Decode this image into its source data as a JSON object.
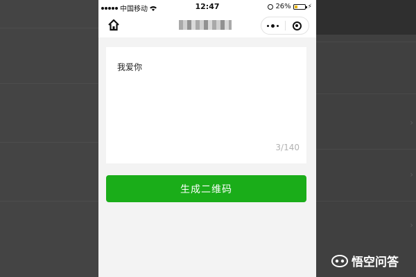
{
  "status_bar": {
    "carrier": "中国移动",
    "time": "12:47",
    "battery": "26%",
    "battery_level": 0.26,
    "battery_color": "#e8b400"
  },
  "nav": {
    "home_icon": "home-icon",
    "more_icon": "more-dots-icon",
    "close_icon": "target-close-icon"
  },
  "editor": {
    "text": "我爱你",
    "char_count": "3/140"
  },
  "actions": {
    "generate_label": "生成二维码",
    "generate_color": "#1aad19"
  },
  "watermark": {
    "text": "悟空问答"
  }
}
